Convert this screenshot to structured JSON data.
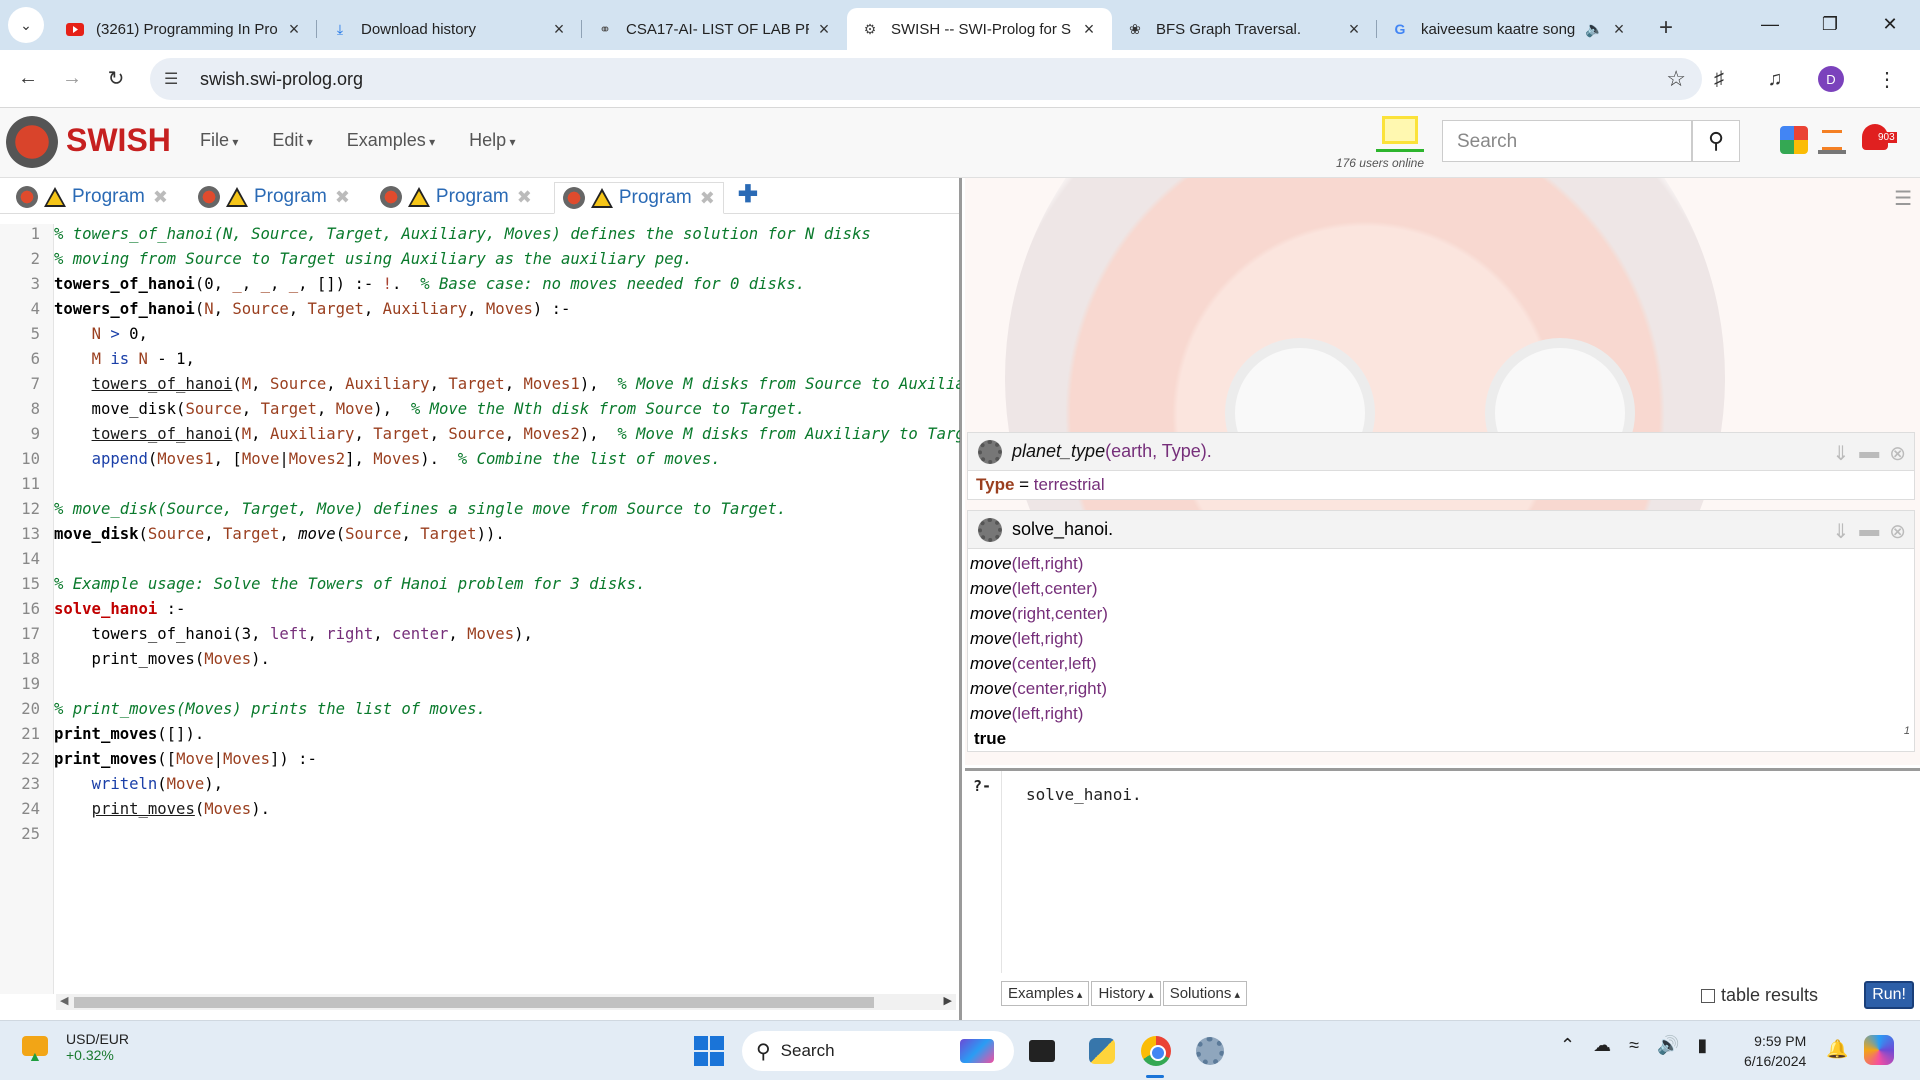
{
  "browser": {
    "tabs": [
      {
        "title": "(3261) Programming In Pro",
        "icon": "youtube-icon",
        "active": false
      },
      {
        "title": "Download history",
        "icon": "download-icon",
        "active": false
      },
      {
        "title": "CSA17-AI- LIST OF LAB PR",
        "icon": "globe-icon",
        "active": false
      },
      {
        "title": "SWISH -- SWI-Prolog for S",
        "icon": "swish-icon",
        "active": true
      },
      {
        "title": "BFS Graph Traversal.",
        "icon": "openai-icon",
        "active": false
      },
      {
        "title": "kaiveesum kaatre song",
        "icon": "google-icon",
        "active": false
      }
    ],
    "url": "swish.swi-prolog.org",
    "profile_initial": "D"
  },
  "swish": {
    "logo_text": "SWISH",
    "menus": [
      "File",
      "Edit",
      "Examples",
      "Help"
    ],
    "users_online": "176 users online",
    "search_placeholder": "Search",
    "notification_count": "903"
  },
  "editor": {
    "tabs": [
      "Program",
      "Program",
      "Program",
      "Program"
    ],
    "active_tab": 3,
    "line_count": 25
  },
  "results": [
    {
      "query_functor": "planet_type",
      "query_args": "(earth, Type).",
      "bindings": [
        {
          "var": "Type",
          "eq": " = ",
          "value": "terrestrial"
        }
      ]
    },
    {
      "query": "solve_hanoi.",
      "output": [
        {
          "f": "move",
          "args": "(left,right)"
        },
        {
          "f": "move",
          "args": "(left,center)"
        },
        {
          "f": "move",
          "args": "(right,center)"
        },
        {
          "f": "move",
          "args": "(left,right)"
        },
        {
          "f": "move",
          "args": "(center,left)"
        },
        {
          "f": "move",
          "args": "(center,right)"
        },
        {
          "f": "move",
          "args": "(left,right)"
        }
      ],
      "result": "true",
      "count": "1"
    }
  ],
  "query": {
    "prompt": "?-",
    "text": "solve_hanoi.",
    "buttons": [
      "Examples",
      "History",
      "Solutions"
    ],
    "table_results_label": "table results",
    "run_label": "Run!"
  },
  "taskbar": {
    "ticker_name": "USD/EUR",
    "ticker_change": "+0.32%",
    "search_label": "Search",
    "time": "9:59 PM",
    "date": "6/16/2024"
  }
}
